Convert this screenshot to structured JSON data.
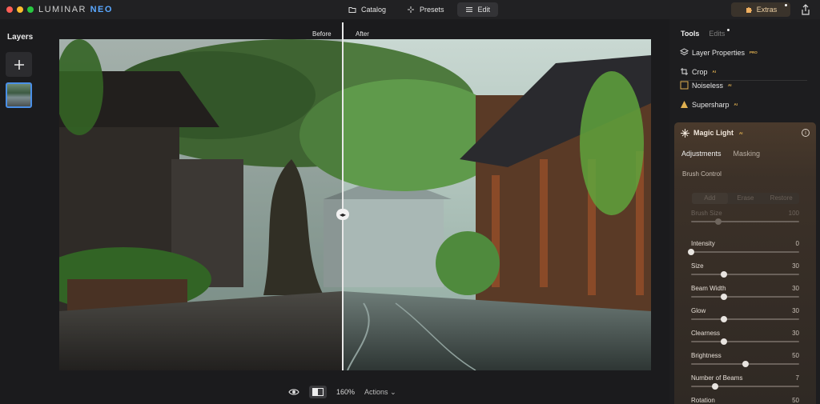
{
  "app": {
    "logo_main": "LUMINAR",
    "logo_accent": "NEO"
  },
  "nav": {
    "catalog": "Catalog",
    "presets": "Presets",
    "edit": "Edit",
    "extras": "Extras"
  },
  "layers": {
    "title": "Layers"
  },
  "canvas": {
    "before": "Before",
    "after": "After",
    "zoom": "160%",
    "actions": "Actions"
  },
  "panel": {
    "tabs": {
      "tools": "Tools",
      "edits": "Edits"
    },
    "tools": [
      {
        "label": "Layer Properties",
        "tag": "PRO"
      },
      {
        "label": "Crop",
        "tag": "AI"
      },
      {
        "label": "Noiseless",
        "tag": "AI"
      },
      {
        "label": "Supersharp",
        "tag": "AI"
      }
    ],
    "magic_light": {
      "title": "Magic Light",
      "tag": "AI",
      "subtabs": {
        "adjustments": "Adjustments",
        "masking": "Masking"
      },
      "brush_control": "Brush Control",
      "brush_buttons": [
        "Add",
        "Erase",
        "Restore"
      ],
      "sliders": [
        {
          "label": "Brush Size",
          "value": "100",
          "pos": 0.25,
          "dim": true
        },
        {
          "label": "Intensity",
          "value": "0",
          "pos": 0.0,
          "dim": false
        },
        {
          "label": "Size",
          "value": "30",
          "pos": 0.3,
          "dim": false
        },
        {
          "label": "Beam Width",
          "value": "30",
          "pos": 0.3,
          "dim": false
        },
        {
          "label": "Glow",
          "value": "30",
          "pos": 0.3,
          "dim": false
        },
        {
          "label": "Clearness",
          "value": "30",
          "pos": 0.3,
          "dim": false
        },
        {
          "label": "Brightness",
          "value": "50",
          "pos": 0.5,
          "dim": false
        },
        {
          "label": "Number of Beams",
          "value": "7",
          "pos": 0.22,
          "dim": false
        },
        {
          "label": "Rotation",
          "value": "50",
          "pos": 0.5,
          "dim": false
        }
      ]
    }
  },
  "colors": {
    "accent_blue": "#4a8fe6",
    "extras_text": "#f0d2a5",
    "magic_panel": "#4a3a2c"
  }
}
